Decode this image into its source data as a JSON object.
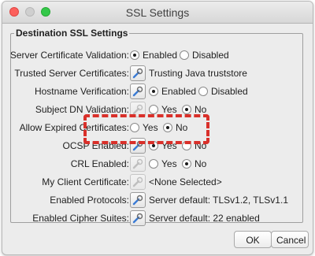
{
  "window": {
    "title": "SSL Settings"
  },
  "group": {
    "legend": "Destination SSL Settings"
  },
  "rows": [
    {
      "label": "Server Certificate Validation:",
      "opt1": "Enabled",
      "opt2": "Disabled"
    },
    {
      "label": "Trusted Server Certificates:",
      "value": "Trusting Java truststore"
    },
    {
      "label": "Hostname Verification:",
      "opt1": "Enabled",
      "opt2": "Disabled"
    },
    {
      "label": "Subject DN Validation:",
      "opt1": "Yes",
      "opt2": "No"
    },
    {
      "label": "Allow Expired Certificates:",
      "opt1": "Yes",
      "opt2": "No"
    },
    {
      "label": "OCSP Enabled:",
      "opt1": "Yes",
      "opt2": "No"
    },
    {
      "label": "CRL Enabled:",
      "opt1": "Yes",
      "opt2": "No"
    },
    {
      "label": "My Client Certificate:",
      "value": "<None Selected>"
    },
    {
      "label": "Enabled Protocols:",
      "value": "Server default: TLSv1.2, TLSv1.1"
    },
    {
      "label": "Enabled Cipher Suites:",
      "value": "Server default: 22 enabled"
    }
  ],
  "buttons": {
    "ok": "OK",
    "cancel": "Cancel"
  },
  "icons": {
    "edit": "wrench-edit-icon"
  },
  "colors": {
    "highlight": "#d9302a",
    "close": "#fc605c",
    "zoom": "#34c84a"
  }
}
